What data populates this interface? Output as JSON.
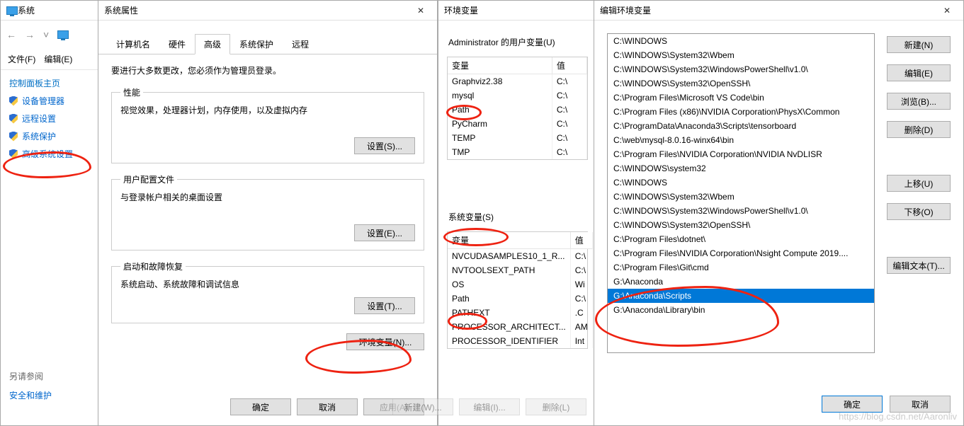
{
  "system_panel": {
    "title": "系统",
    "menu": {
      "file": "文件(F)",
      "edit": "编辑(E)"
    },
    "cp_home": "控制面板主页",
    "links": {
      "device_mgr": "设备管理器",
      "remote": "远程设置",
      "protection": "系统保护",
      "adv": "高级系统设置"
    },
    "see_also": "另请参阅",
    "security": "安全和维护"
  },
  "sys_props": {
    "title": "系统属性",
    "tabs": {
      "computer": "计算机名",
      "hardware": "硬件",
      "advanced": "高级",
      "protection": "系统保护",
      "remote": "远程"
    },
    "note": "要进行大多数更改，您必须作为管理员登录。",
    "perf": {
      "legend": "性能",
      "desc": "视觉效果，处理器计划，内存使用，以及虚拟内存",
      "btn": "设置(S)..."
    },
    "profile": {
      "legend": "用户配置文件",
      "desc": "与登录帐户相关的桌面设置",
      "btn": "设置(E)..."
    },
    "startup": {
      "legend": "启动和故障恢复",
      "desc": "系统启动、系统故障和调试信息",
      "btn": "设置(T)..."
    },
    "env_btn": "环境变量(N)...",
    "ok": "确定",
    "cancel": "取消",
    "apply": "应用(A)"
  },
  "env_vars": {
    "title": "环境变量",
    "user_section": "Administrator 的用户变量(U)",
    "col_var": "变量",
    "col_val": "值",
    "user_rows": [
      {
        "var": "Graphviz2.38",
        "val": "C:\\"
      },
      {
        "var": "mysql",
        "val": "C:\\"
      },
      {
        "var": "Path",
        "val": "C:\\"
      },
      {
        "var": "PyCharm",
        "val": "C:\\"
      },
      {
        "var": "TEMP",
        "val": "C:\\"
      },
      {
        "var": "TMP",
        "val": "C:\\"
      }
    ],
    "sys_section": "系统变量(S)",
    "sys_rows": [
      {
        "var": "NVCUDASAMPLES10_1_R...",
        "val": "C:\\"
      },
      {
        "var": "NVTOOLSEXT_PATH",
        "val": "C:\\"
      },
      {
        "var": "OS",
        "val": "Wi"
      },
      {
        "var": "Path",
        "val": "C:\\"
      },
      {
        "var": "PATHEXT",
        "val": ".C"
      },
      {
        "var": "PROCESSOR_ARCHITECT...",
        "val": "AM"
      },
      {
        "var": "PROCESSOR_IDENTIFIER",
        "val": "Int"
      }
    ],
    "new_btn": "新建(W)...",
    "edit_btn": "编辑(I)...",
    "del_btn": "删除(L)"
  },
  "edit_env": {
    "title": "编辑环境变量",
    "items": [
      "C:\\WINDOWS",
      "C:\\WINDOWS\\System32\\Wbem",
      "C:\\WINDOWS\\System32\\WindowsPowerShell\\v1.0\\",
      "C:\\WINDOWS\\System32\\OpenSSH\\",
      "C:\\Program Files\\Microsoft VS Code\\bin",
      "C:\\Program Files (x86)\\NVIDIA Corporation\\PhysX\\Common",
      "C:\\ProgramData\\Anaconda3\\Scripts\\tensorboard",
      "C:\\web\\mysql-8.0.16-winx64\\bin",
      "C:\\Program Files\\NVIDIA Corporation\\NVIDIA NvDLISR",
      "C:\\WINDOWS\\system32",
      "C:\\WINDOWS",
      "C:\\WINDOWS\\System32\\Wbem",
      "C:\\WINDOWS\\System32\\WindowsPowerShell\\v1.0\\",
      "C:\\WINDOWS\\System32\\OpenSSH\\",
      "C:\\Program Files\\dotnet\\",
      "C:\\Program Files\\NVIDIA Corporation\\Nsight Compute 2019....",
      "C:\\Program Files\\Git\\cmd",
      "G:\\Anaconda",
      "G:\\Anaconda\\Scripts",
      "G:\\Anaconda\\Library\\bin"
    ],
    "selected_index": 18,
    "btns": {
      "new": "新建(N)",
      "edit": "编辑(E)",
      "browse": "浏览(B)...",
      "delete": "删除(D)",
      "up": "上移(U)",
      "down": "下移(O)",
      "edit_text": "编辑文本(T)..."
    },
    "ok": "确定",
    "cancel": "取消"
  },
  "watermark": "https://blog.csdn.net/Aaronliv"
}
